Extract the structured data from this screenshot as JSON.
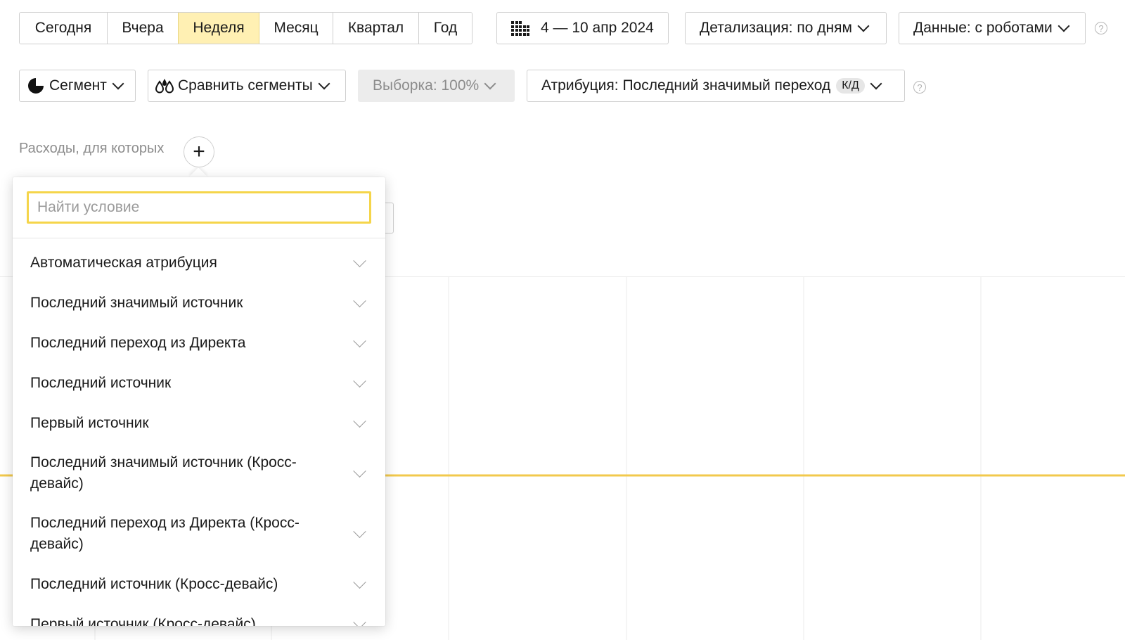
{
  "toolbar": {
    "periods": [
      {
        "label": "Сегодня",
        "active": false
      },
      {
        "label": "Вчера",
        "active": false
      },
      {
        "label": "Неделя",
        "active": true
      },
      {
        "label": "Месяц",
        "active": false
      },
      {
        "label": "Квартал",
        "active": false
      },
      {
        "label": "Год",
        "active": false
      }
    ],
    "date_range": "4 — 10 апр 2024",
    "detail_label": "Детализация: по дням",
    "data_label": "Данные: с роботами",
    "help_glyph": "?"
  },
  "row2": {
    "segment_label": "Сегмент",
    "compare_label": "Сравнить сегменты",
    "sample_label": "Выборка: 100%",
    "attribution_label": "Атрибуция: Последний значимый переход",
    "attribution_badge": "К/Д",
    "help_glyph": "?"
  },
  "filter": {
    "label": "Расходы, для которых",
    "add_glyph": "+"
  },
  "popup": {
    "search_placeholder": "Найти условие",
    "search_value": "",
    "items": [
      "Автоматическая атрибуция",
      "Последний значимый источник",
      "Последний переход из Директа",
      "Последний источник",
      "Первый источник",
      "Последний значимый источник (Кросс-девайс)",
      "Последний переход из Директа (Кросс-девайс)",
      "Последний источник (Кросс-девайс)",
      "Первый источник (Кросс-девайс)"
    ]
  },
  "colors": {
    "accent_yellow": "#f5d54a",
    "active_tab": "#fff0b3",
    "chart_line": "#f2c94c",
    "grid_line": "#ebebeb"
  }
}
